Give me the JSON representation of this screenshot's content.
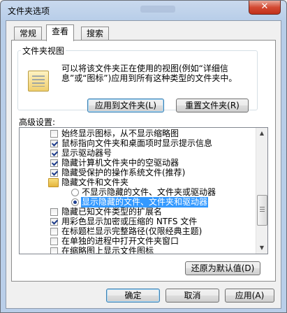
{
  "window": {
    "title": "文件夹选项",
    "close_label": "✕"
  },
  "tabs": [
    {
      "label": "常规",
      "active": false
    },
    {
      "label": "查看",
      "active": true
    },
    {
      "label": "搜索",
      "active": false
    }
  ],
  "folder_views": {
    "legend": "文件夹视图",
    "description": "可以将该文件夹正在使用的视图(例如“详细信息”或“图标”)应用到所有这种类型的文件夹中。",
    "apply_button": "应用到文件夹(L)",
    "reset_button": "重置文件夹(R)"
  },
  "advanced": {
    "label": "高级设置:",
    "items": [
      {
        "type": "checkbox",
        "checked": false,
        "label": "始终显示图标，从不显示缩略图"
      },
      {
        "type": "checkbox",
        "checked": true,
        "label": "鼠标指向文件夹和桌面项时显示提示信息"
      },
      {
        "type": "checkbox",
        "checked": true,
        "label": "显示驱动器号"
      },
      {
        "type": "checkbox",
        "checked": true,
        "label": "隐藏计算机文件夹中的空驱动器"
      },
      {
        "type": "checkbox",
        "checked": true,
        "label": "隐藏受保护的操作系统文件(推荐)"
      },
      {
        "type": "folder",
        "label": "隐藏文件和文件夹"
      },
      {
        "type": "radio",
        "checked": false,
        "label": "不显示隐藏的文件、文件夹或驱动器"
      },
      {
        "type": "radio",
        "checked": true,
        "selected": true,
        "label": "显示隐藏的文件、文件夹和驱动器"
      },
      {
        "type": "checkbox",
        "checked": false,
        "label": "隐藏已知文件类型的扩展名"
      },
      {
        "type": "checkbox",
        "checked": true,
        "label": "用彩色显示加密或压缩的 NTFS 文件"
      },
      {
        "type": "checkbox",
        "checked": false,
        "label": "在标题栏显示完整路径(仅限经典主题)"
      },
      {
        "type": "checkbox",
        "checked": false,
        "label": "在单独的进程中打开文件夹窗口"
      },
      {
        "type": "checkbox",
        "checked": false,
        "label": "在缩略图上显示文件图标"
      }
    ],
    "restore_button": "还原为默认值(D)"
  },
  "footer": {
    "ok": "确定",
    "cancel": "取消",
    "apply": "应用(A)"
  },
  "icons": {
    "scroll_up": "▲",
    "scroll_down": "▼"
  }
}
